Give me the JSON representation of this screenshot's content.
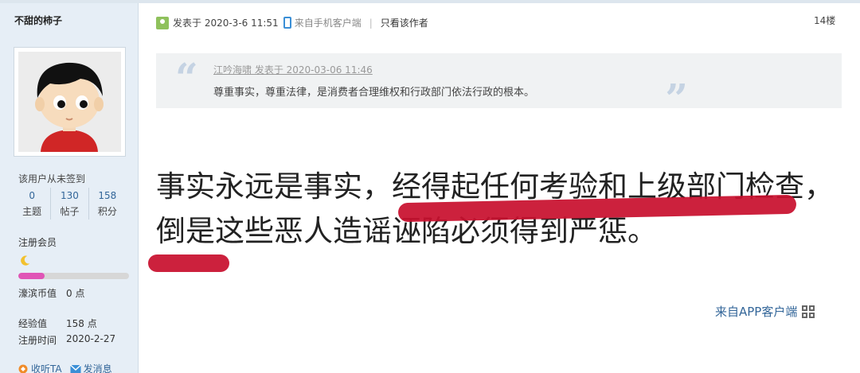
{
  "author": {
    "name": "不甜的柿子",
    "sign_status": "该用户从未签到",
    "stats": [
      {
        "num": "0",
        "label": "主题"
      },
      {
        "num": "130",
        "label": "帖子"
      },
      {
        "num": "158",
        "label": "积分"
      }
    ],
    "group": "注册会员",
    "level_progress": 0.24,
    "currency_label": "濠滨币值",
    "currency_value": "0 点",
    "exp_label": "经验值",
    "exp_value": "158 点",
    "reg_label": "注册时间",
    "reg_value": "2020-2-27",
    "actions": {
      "follow": "收听TA",
      "message": "发消息"
    }
  },
  "post": {
    "posted_at": "发表于 2020-3-6 11:51",
    "mobile_source": "来自手机客户端",
    "only_author": "只看该作者",
    "floor": "14楼",
    "quote": {
      "author_line": "江吟海啸 发表于 2020-03-06 11:46",
      "text": "尊重事实，尊重法律，是消费者合理维权和行政部门依法行政的根本。"
    },
    "body": "事实永远是事实，经得起任何考验和上级部门检查，倒是这些恶人造谣诬陷必须得到严惩。",
    "app_source": "来自APP客户端"
  },
  "colors": {
    "sidebar_bg": "#e6eef6",
    "link": "#336699",
    "highlight_red": "#c8102e",
    "level_fill": "#e055b6"
  }
}
